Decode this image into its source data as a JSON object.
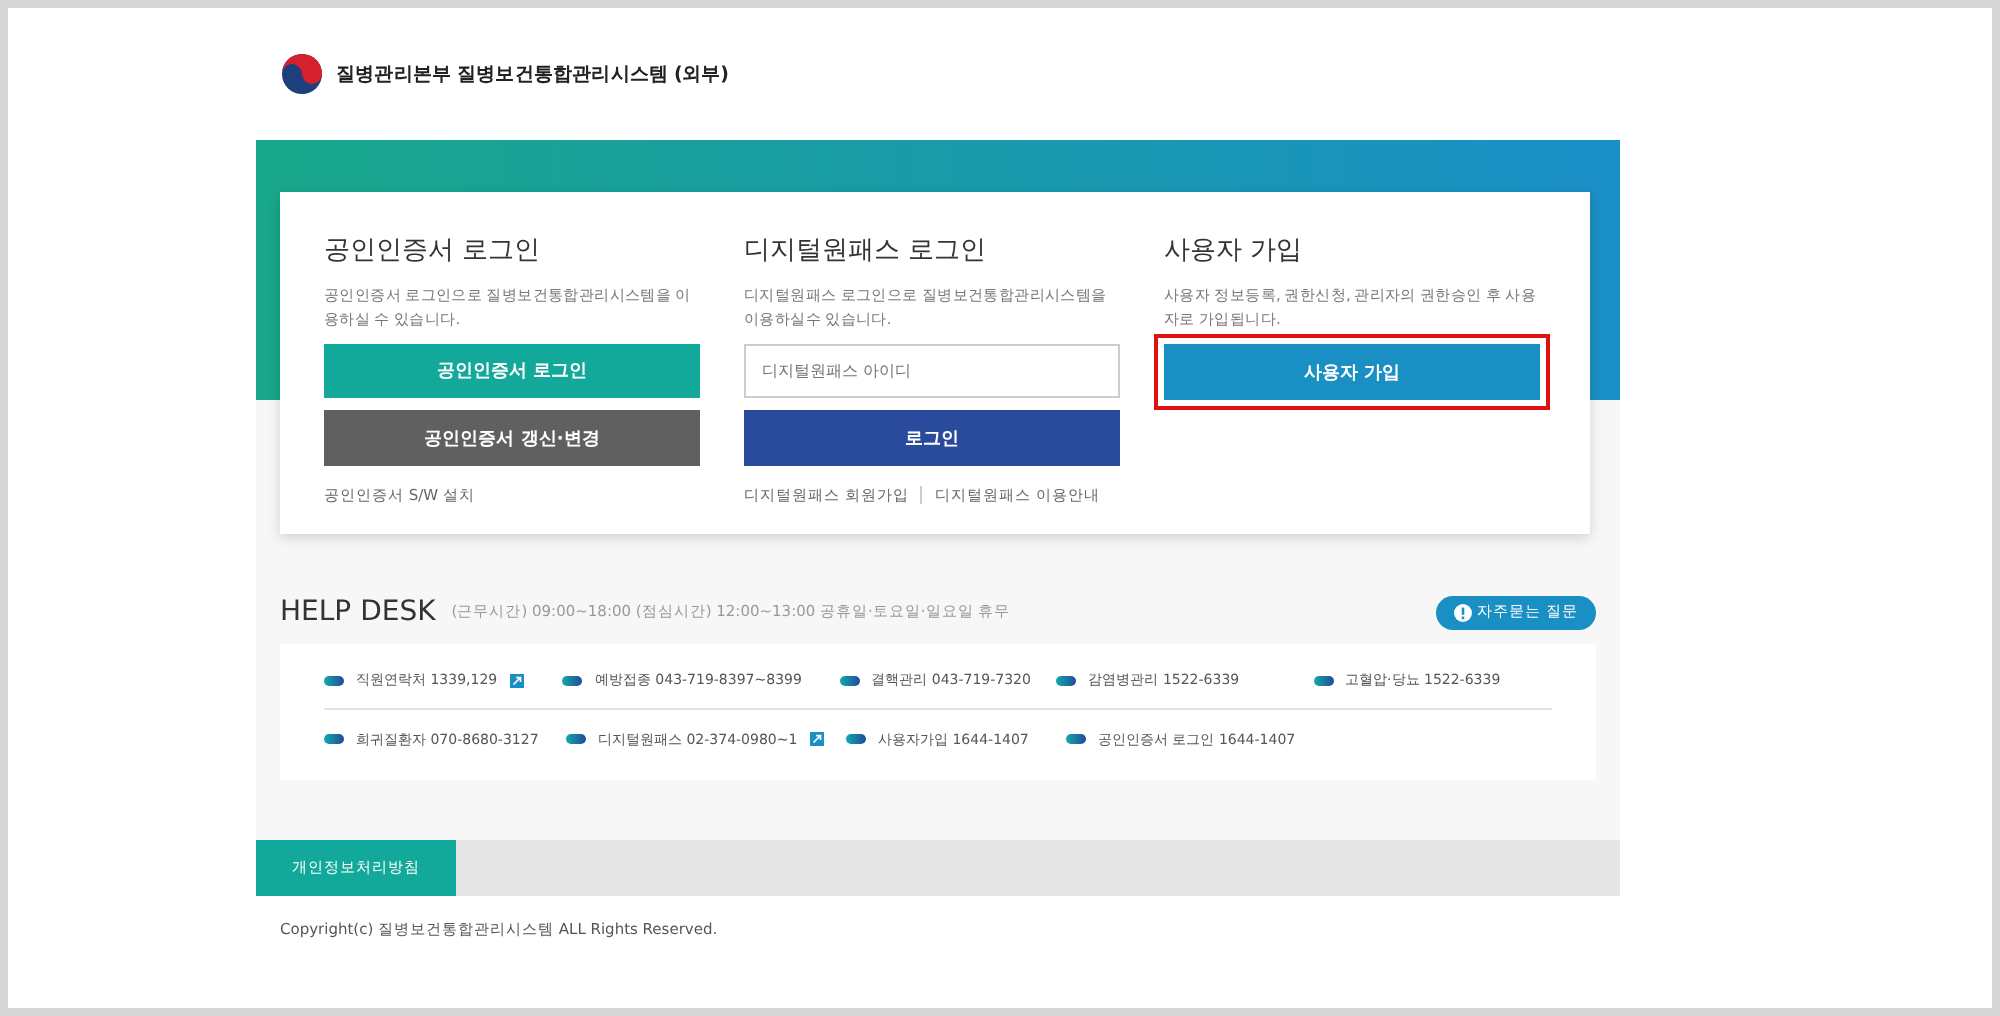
{
  "header": {
    "title": "질병관리본부 질병보건통합관리시스템 (외부)"
  },
  "login_panels": [
    {
      "title": "공인인증서 로그인",
      "description": "공인인증서 로그인으로 질병보건통합관리시스템을 이용하실 수 있습니다.",
      "buttons": [
        {
          "label": "공인인증서 로그인",
          "color": "#12a89a"
        },
        {
          "label": "공인인증서 갱신·변경",
          "color": "#606060"
        }
      ],
      "links": [
        "공인인증서 S/W 설치"
      ],
      "highlighted": false
    },
    {
      "title": "디지털원패스 로그인",
      "description": "디지털원패스 로그인으로 질병보건통합관리시스템을 이용하실수 있습니다.",
      "field": {
        "placeholder": "디지털원패스 아이디"
      },
      "buttons": [
        {
          "label": "로그인",
          "color": "#2a4a9c"
        }
      ],
      "links": [
        "디지털원패스 회원가입",
        "디지털원패스 이용안내"
      ],
      "highlighted": false
    },
    {
      "title": "사용자 가입",
      "description": "사용자 정보등록, 권한신청, 관리자의 권한승인 후 사용자로 가입됩니다.",
      "buttons": [
        {
          "label": "사용자 가입",
          "color": "#1a8fc4"
        }
      ],
      "highlighted": true
    }
  ],
  "help_desk": {
    "title": "HELP DESK",
    "hours": "(근무시간) 09:00~18:00 (점심시간) 12:00~13:00 공휴일·토요일·일요일 휴무",
    "faq_button": "자주묻는 질문",
    "rows": [
      [
        {
          "label": "직원연락처 1339,129",
          "external": true
        },
        {
          "label": "예방접종 043-719-8397~8399",
          "external": false
        },
        {
          "label": "결핵관리 043-719-7320",
          "external": false
        },
        {
          "label": "감염병관리 1522-6339",
          "external": false
        },
        {
          "label": "고혈압·당뇨 1522-6339",
          "external": false
        }
      ],
      [
        {
          "label": "희귀질환자 070-8680-3127",
          "external": false
        },
        {
          "label": "디지털원패스 02-374-0980~1",
          "external": true
        },
        {
          "label": "사용자가입 1644-1407",
          "external": false
        },
        {
          "label": "공인인증서 로그인 1644-1407",
          "external": false
        }
      ]
    ]
  },
  "footer": {
    "tabs": [
      {
        "label": "개인정보처리방침",
        "selected": true
      }
    ],
    "copyright": "Copyright(c) 질병보건통합관리시스템 ALL Rights Reserved."
  }
}
